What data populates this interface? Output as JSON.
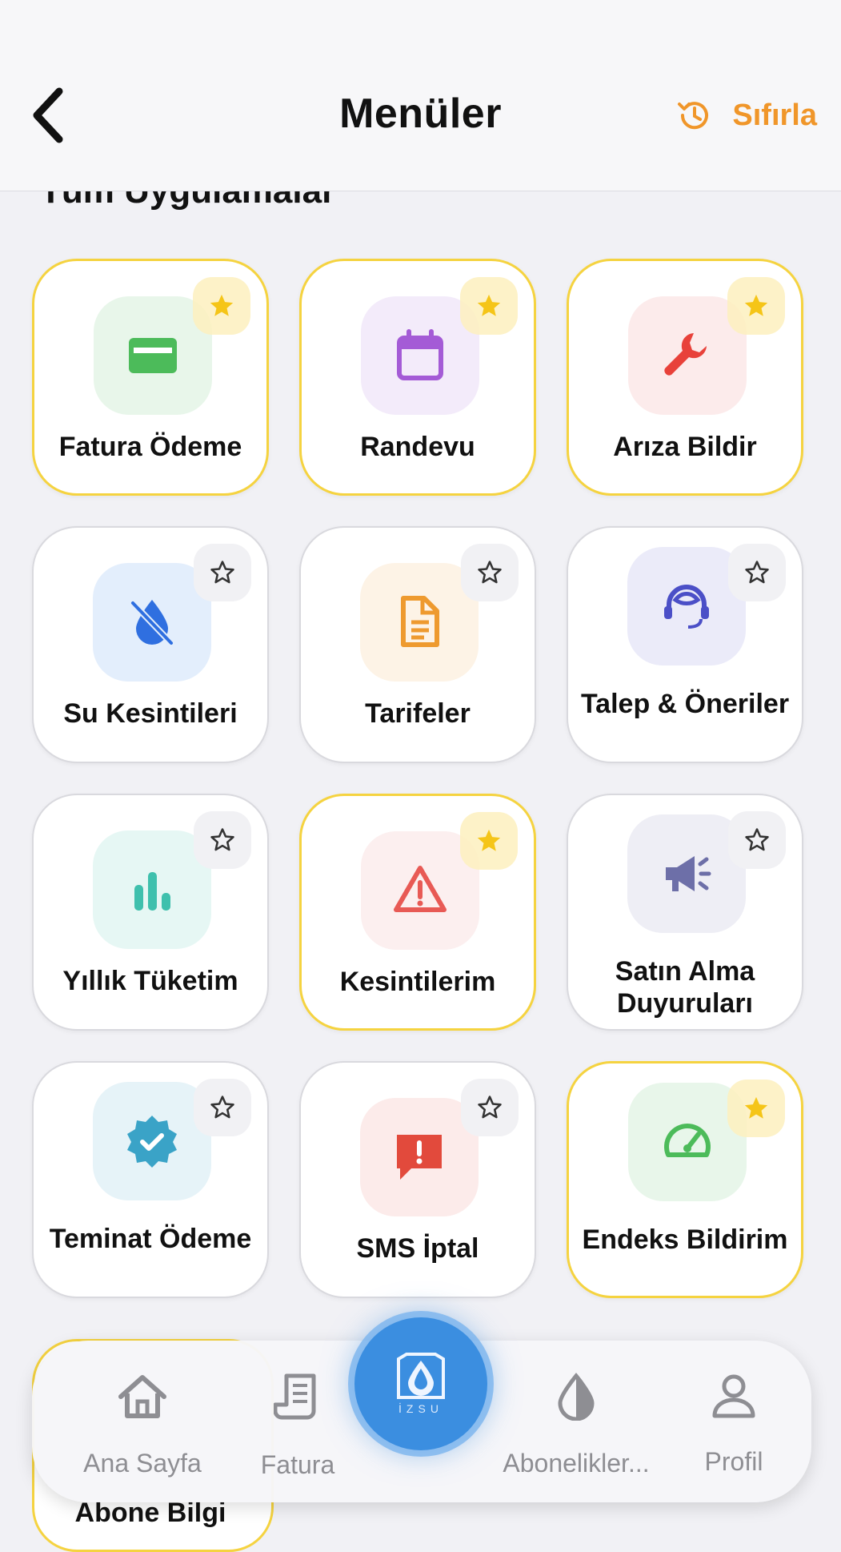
{
  "header": {
    "title": "Menüler",
    "reset_label": "Sıfırla",
    "accent_color": "#f0962a"
  },
  "section_title": "Tüm Uygulamalar",
  "cards": [
    {
      "label": "Fatura Ödeme",
      "icon": "credit-card-icon",
      "favorite": true,
      "tile_color": "#e8f6ea",
      "icon_color": "#4cbb5a"
    },
    {
      "label": "Randevu",
      "icon": "calendar-icon",
      "favorite": true,
      "tile_color": "#f3ebfa",
      "icon_color": "#a45bd6"
    },
    {
      "label": "Arıza Bildir",
      "icon": "wrench-icon",
      "favorite": true,
      "tile_color": "#fcebeb",
      "icon_color": "#e8413a"
    },
    {
      "label": "Su Kesintileri",
      "icon": "water-off-icon",
      "favorite": false,
      "tile_color": "#e3eefc",
      "icon_color": "#2f6fe0"
    },
    {
      "label": "Tarifeler",
      "icon": "document-icon",
      "favorite": false,
      "tile_color": "#fdf3e6",
      "icon_color": "#ee9a2f"
    },
    {
      "label": "Talep & Öneriler",
      "icon": "headset-icon",
      "favorite": false,
      "tile_color": "#ebebf9",
      "icon_color": "#4b4fc7"
    },
    {
      "label": "Yıllık Tüketim",
      "icon": "bar-chart-icon",
      "favorite": false,
      "tile_color": "#e6f7f4",
      "icon_color": "#3fc0ad"
    },
    {
      "label": "Kesintilerim",
      "icon": "warning-icon",
      "favorite": true,
      "tile_color": "#fcefef",
      "icon_color": "#e85a55"
    },
    {
      "label": "Satın Alma Duyuruları",
      "icon": "megaphone-icon",
      "favorite": false,
      "tile_color": "#eeeef5",
      "icon_color": "#6d6fa8"
    },
    {
      "label": "Teminat Ödeme",
      "icon": "verified-badge-icon",
      "favorite": false,
      "tile_color": "#e6f3f8",
      "icon_color": "#3aa3c7"
    },
    {
      "label": "SMS İptal",
      "icon": "message-alert-icon",
      "favorite": false,
      "tile_color": "#fcebea",
      "icon_color": "#e24a3c"
    },
    {
      "label": "Endeks Bildirim",
      "icon": "gauge-icon",
      "favorite": true,
      "tile_color": "#e8f6ea",
      "icon_color": "#4cbb5a"
    }
  ],
  "next_card_label": "Abone Bilgi",
  "nav": {
    "items": [
      {
        "label": "Ana Sayfa",
        "icon": "home-icon"
      },
      {
        "label": "Fatura",
        "icon": "receipt-icon"
      },
      {
        "label": "Abonelikler...",
        "icon": "water-drop-icon"
      },
      {
        "label": "Profil",
        "icon": "user-icon"
      }
    ],
    "center_logo_text": "İZSU",
    "center_color": "#3b8ee0"
  },
  "colors": {
    "favorite_border": "#f5d340",
    "star_fill": "#f5c518",
    "background": "#f1f1f5"
  }
}
